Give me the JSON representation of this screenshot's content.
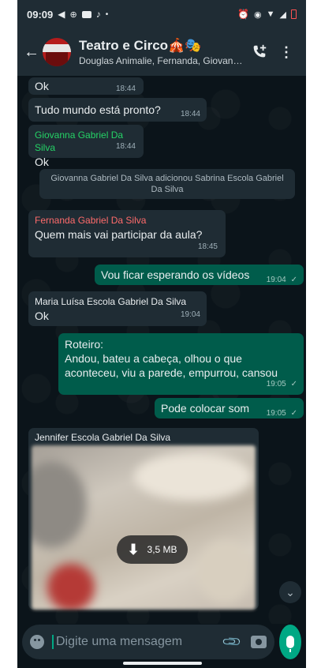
{
  "status_bar": {
    "time": "09:09",
    "left_icons": [
      "send-icon",
      "voicemail-icon",
      "tv-icon",
      "tiktok-icon",
      "dot-icon"
    ],
    "right_icons": [
      "alarm-icon",
      "vibrate-icon",
      "wifi-icon",
      "signal-h-icon",
      "battery-low-icon"
    ]
  },
  "header": {
    "title": "Teatro e Circo🎪🎭",
    "members": "Douglas Animalie, Fernanda, Giovanna , ..."
  },
  "messages": [
    {
      "type": "in",
      "text": "Ok",
      "time": "18:44"
    },
    {
      "type": "in",
      "text": "Tudo mundo está pronto?",
      "time": "18:44"
    },
    {
      "type": "in",
      "sender": "Giovanna Gabriel Da Silva",
      "sender_color": "#25d366",
      "text": "Ok",
      "time": "18:44"
    },
    {
      "type": "system",
      "text": "Giovanna Gabriel Da Silva adicionou Sabrina Escola Gabriel Da Silva"
    },
    {
      "type": "in",
      "sender": "Fernanda Gabriel Da Silva",
      "sender_color": "#ff6b6b",
      "text": "Quem mais vai participar da aula?",
      "time": "18:45"
    },
    {
      "type": "out",
      "text": "Vou ficar esperando os vídeos",
      "time": "19:04"
    },
    {
      "type": "in",
      "sender": "Maria Luísa Escola Gabriel Da Silva",
      "sender_color": "#e9edef",
      "text": "Ok",
      "time": "19:04"
    },
    {
      "type": "out",
      "text": "Roteiro:\nAndou, bateu a cabeça, olhou o que aconteceu, viu a parede, empurrou, cansou",
      "time": "19:05"
    },
    {
      "type": "out",
      "text": "Pode colocar som",
      "time": "19:05"
    },
    {
      "type": "media",
      "sender": "Jennifer Escola Gabriel Da Silva",
      "sender_color": "#e9edef",
      "download_size": "3,5 MB"
    }
  ],
  "tick": "✓",
  "input": {
    "placeholder": "Digite uma mensagem"
  },
  "colors": {
    "outgoing": "#005c4b",
    "incoming": "#1f2c34",
    "accent": "#00a884",
    "background": "#0b141a"
  }
}
